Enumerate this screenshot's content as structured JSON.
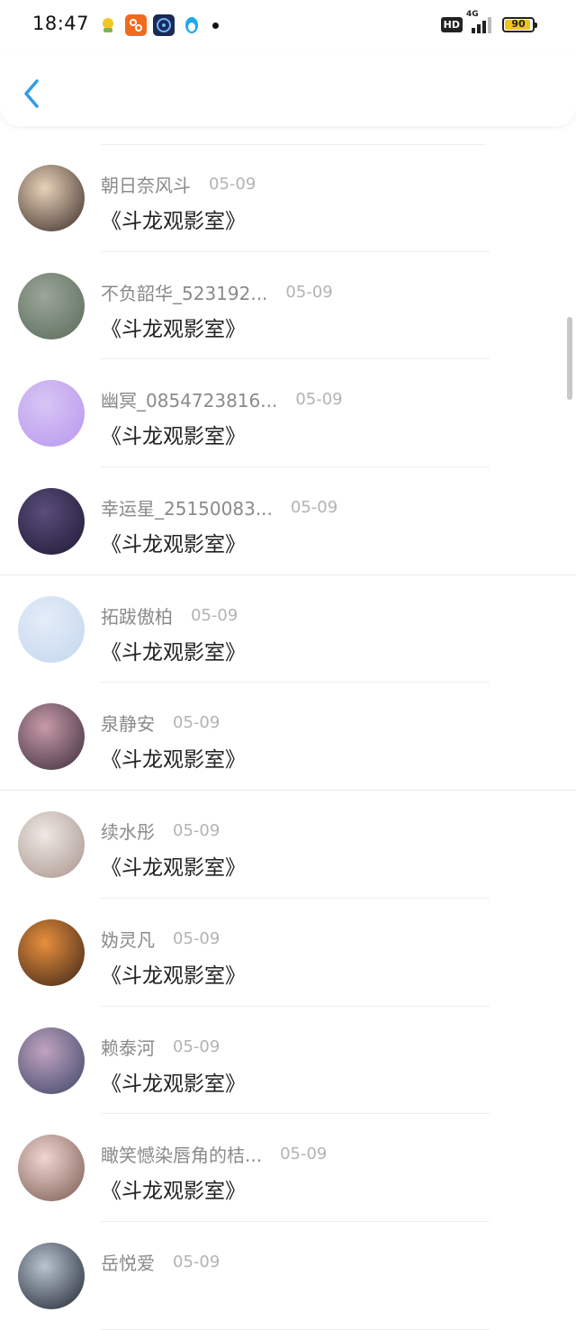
{
  "status_bar": {
    "time": "18:47",
    "hd": "HD",
    "network": "4G",
    "battery": "90",
    "notification_icons": [
      "weather-icon",
      "app-icon-orange",
      "game-icon",
      "qq-penguin-icon"
    ]
  },
  "header": {
    "back_icon": "chevron-left-icon"
  },
  "comments": [
    {
      "username": "朝日奈风斗",
      "date": "05-09",
      "text": "《斗龙观影室》",
      "avatar_colors": [
        "#e8d2b8",
        "#3a2c28"
      ]
    },
    {
      "username": "不负韶华_523192...",
      "date": "05-09",
      "text": "《斗龙观影室》",
      "avatar_colors": [
        "#9aa69a",
        "#5a6a58"
      ]
    },
    {
      "username": "幽冥_0854723816...",
      "date": "05-09",
      "text": "《斗龙观影室》",
      "avatar_colors": [
        "#d8c6f4",
        "#b896ee"
      ]
    },
    {
      "username": "幸运星_25150083...",
      "date": "05-09",
      "text": "《斗龙观影室》",
      "avatar_colors": [
        "#5a4d7a",
        "#1e1a36"
      ]
    },
    {
      "username": "拓跋傲柏",
      "date": "05-09",
      "text": "《斗龙观影室》",
      "avatar_colors": [
        "#e4edf8",
        "#c4d6ee"
      ]
    },
    {
      "username": "泉静安",
      "date": "05-09",
      "text": "《斗龙观影室》",
      "avatar_colors": [
        "#c89aa8",
        "#3a2c3c"
      ]
    },
    {
      "username": "续水彤",
      "date": "05-09",
      "text": "《斗龙观影室》",
      "avatar_colors": [
        "#efe8e4",
        "#a6948c"
      ]
    },
    {
      "username": "妫灵凡",
      "date": "05-09",
      "text": "《斗龙观影室》",
      "avatar_colors": [
        "#e88f3c",
        "#3a2418"
      ]
    },
    {
      "username": "赖泰河",
      "date": "05-09",
      "text": "《斗龙观影室》",
      "avatar_colors": [
        "#c0a4c0",
        "#3c4468"
      ]
    },
    {
      "username": "瞰笑憾染唇角的桔...",
      "date": "05-09",
      "text": "《斗龙观影室》",
      "avatar_colors": [
        "#f0d6d0",
        "#7a5a52"
      ]
    },
    {
      "username": "岳悦爱",
      "date": "05-09",
      "text": "",
      "avatar_colors": [
        "#b8c4d0",
        "#1e2430"
      ]
    }
  ],
  "colors": {
    "accent": "#2f9be8",
    "username": "#8a8a8a",
    "date": "#b3b3b3",
    "comment": "#222222"
  }
}
